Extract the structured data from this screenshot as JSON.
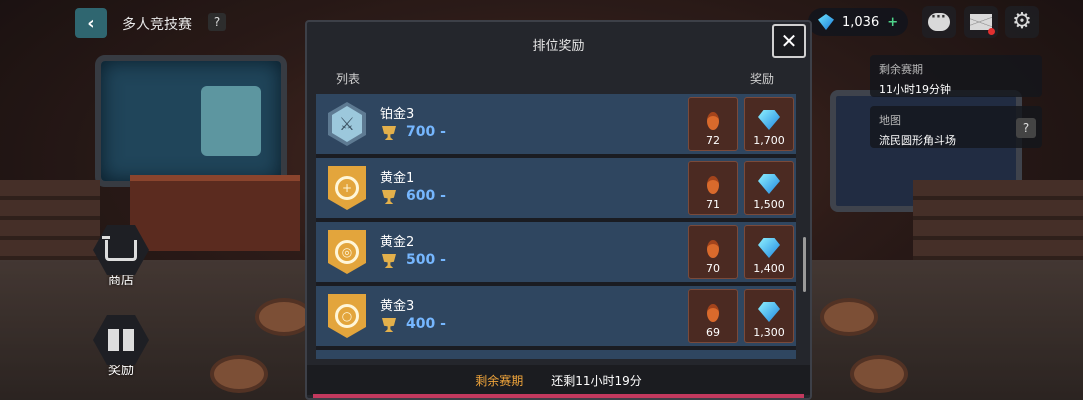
{
  "top_bar": {
    "back_icon": "chevron-left-icon",
    "title": "多人竞技赛",
    "help": "?",
    "gems": "1,036",
    "plus": "+"
  },
  "info_panel": {
    "season_label": "剩余赛期",
    "season_value": "11小时19分钟",
    "map_label": "地图",
    "map_value": "流民圆形角斗场",
    "help": "?"
  },
  "side_menu": {
    "shop": "商店",
    "reward": "奖励"
  },
  "modal": {
    "title": "排位奖励",
    "close": "✕",
    "col_list": "列表",
    "col_reward": "奖励",
    "rows": [
      {
        "name": "铂金3",
        "points": "700 -",
        "medals": "72",
        "gems": "1,700",
        "tier": "platinum"
      },
      {
        "name": "黄金1",
        "points": "600 -",
        "medals": "71",
        "gems": "1,500",
        "tier": "gold"
      },
      {
        "name": "黄金2",
        "points": "500 -",
        "medals": "70",
        "gems": "1,400",
        "tier": "gold"
      },
      {
        "name": "黄金3",
        "points": "400 -",
        "medals": "69",
        "gems": "1,300",
        "tier": "gold"
      }
    ],
    "footer_label": "剩余赛期",
    "footer_value": "还剩11小时19分"
  },
  "colors": {
    "row_bg": "#2f4660",
    "points": "#76b7ff",
    "footer_label": "#f0a53b",
    "accent_pink": "#c2395e"
  }
}
